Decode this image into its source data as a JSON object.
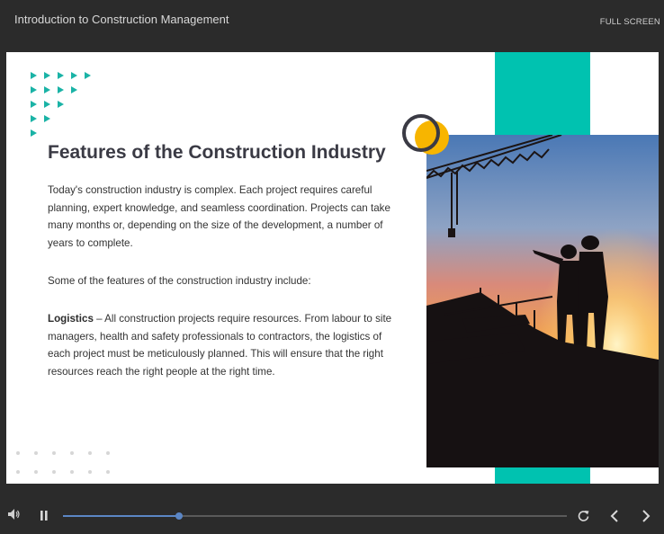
{
  "header": {
    "course_title": "Introduction to Construction Management",
    "fullscreen_label": "FULL SCREEN"
  },
  "slide": {
    "heading": "Features of the Construction Industry",
    "paragraph1": "Today's construction industry is complex. Each project requires careful planning, expert knowledge, and seamless coordination. Projects can take many months or, depending on the size of the development, a number of years to complete.",
    "paragraph2": "Some of the features of the construction industry include:",
    "logistics_term": "Logistics",
    "logistics_text": " – All construction projects require resources. From labour to site managers, health and safety professionals to contractors, the logistics of each project must be meticulously planned. This will ensure that the right resources reach the right people at the right time."
  },
  "player": {
    "progress_fraction": 0.23,
    "icons": [
      "volume-icon",
      "pause-icon",
      "replay-icon",
      "chevron-left-icon",
      "chevron-right-icon"
    ]
  },
  "colors": {
    "accent_teal": "#00c2b0",
    "accent_yellow": "#f7b500",
    "progress_blue": "#5b86c5",
    "chrome_bg": "#2b2b2b"
  }
}
